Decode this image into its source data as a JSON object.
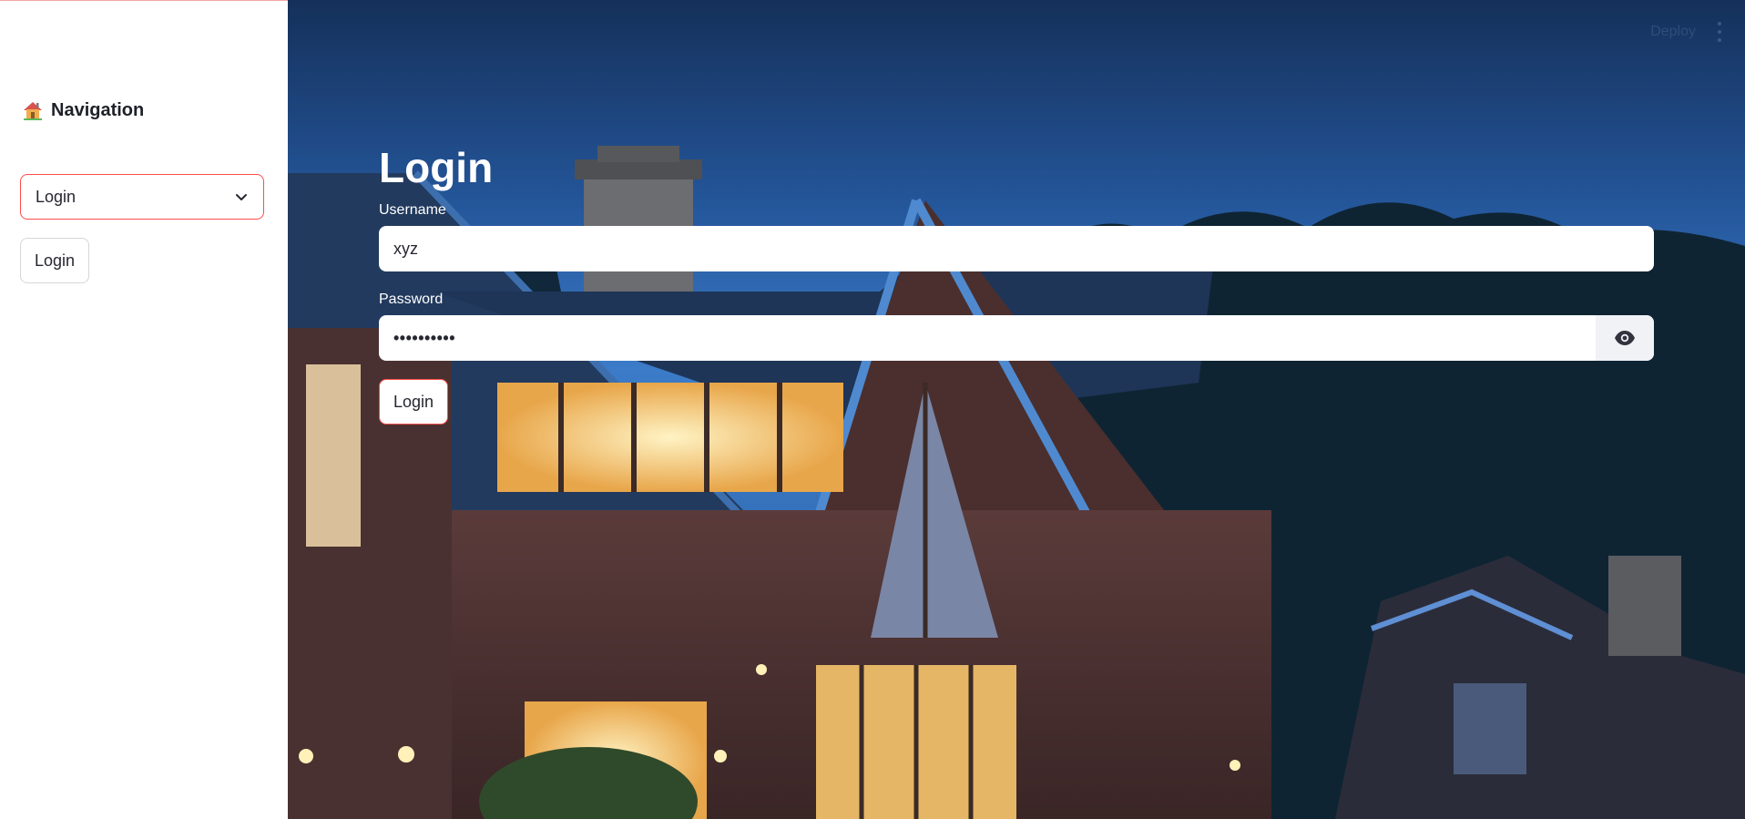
{
  "sidebar": {
    "title": "Navigation",
    "title_icon": "house-icon",
    "select": {
      "value": "Login",
      "icon": "chevron-down-icon"
    },
    "button_label": "Login"
  },
  "toolbar": {
    "deploy_label": "Deploy",
    "menu_icon": "kebab-menu-icon"
  },
  "main": {
    "title": "Login",
    "username": {
      "label": "Username",
      "value": "xyz"
    },
    "password": {
      "label": "Password",
      "value": "••••••••••",
      "toggle_icon": "eye-icon"
    },
    "submit_label": "Login"
  },
  "colors": {
    "accent": "#ff4b4b",
    "sky_top": "#1f4e8c",
    "sky_bottom": "#3a78c9",
    "input_bg": "#ffffff"
  }
}
